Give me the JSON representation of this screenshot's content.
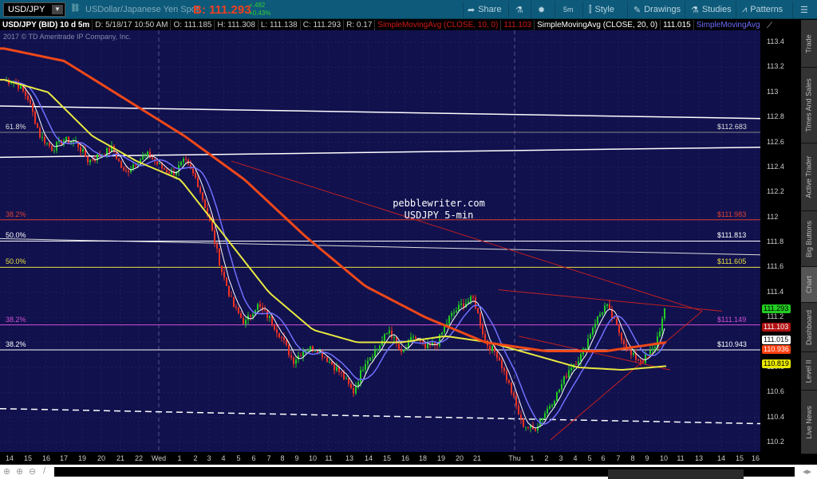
{
  "toolbar": {
    "symbol": "USD/JPY",
    "description": "USDollar/Japanese Yen Spot",
    "bid": "B: 111.293",
    "change": "+.482",
    "change_pct": "+0.43%",
    "share": "Share",
    "timeframe": "5m",
    "style": "Style",
    "drawings": "Drawings",
    "studies": "Studies",
    "patterns": "Patterns"
  },
  "info": {
    "title": "USD/JPY (BID) 10 d 5m",
    "date": "D: 5/18/17 10:50 AM",
    "open": "O: 111.185",
    "high": "H: 111.308",
    "low": "L: 111.138",
    "close": "C: 111.293",
    "range": "R: 0.17",
    "sma1": "SimpleMovingAvg (CLOSE, 10, 0)",
    "sma1_val": "111.103",
    "sma2": "SimpleMovingAvg (CLOSE, 20, 0)",
    "sma2_val": "111.015",
    "sma3": "SimpleMovingAvg ..."
  },
  "copyright": "2017 © TD Ameritrade IP Company, Inc.",
  "watermark": {
    "line1": "pebblewriter.com",
    "line2": "USDJPY 5-min"
  },
  "fib_labels": [
    {
      "pct": "61.8%",
      "price": 112.68,
      "value": "$112.683",
      "color": "#dddddd"
    },
    {
      "pct": "38.2%",
      "price": 111.98,
      "value": "$111.983",
      "color": "#e04030"
    },
    {
      "pct": "50.0%",
      "price": 111.81,
      "value": "$111.813",
      "color": "#ffffff"
    },
    {
      "pct": "50.0%",
      "price": 111.6,
      "value": "$111.605",
      "color": "#e8e040"
    },
    {
      "pct": "38.2%",
      "price": 111.14,
      "value": "$111.149",
      "color": "#d050d0"
    },
    {
      "pct": "38.2%",
      "price": 110.94,
      "value": "$110.943",
      "color": "#ffffff"
    }
  ],
  "y_ticks": [
    "113.4",
    "113.2",
    "113",
    "112.8",
    "112.6",
    "112.4",
    "112.2",
    "112",
    "111.8",
    "111.6",
    "111.4",
    "111.2",
    "111",
    "110.8",
    "110.6",
    "110.4",
    "110.2"
  ],
  "badges": [
    {
      "label": "111.293",
      "price": 111.29,
      "bg": "#22cc22",
      "fg": "#000"
    },
    {
      "label": "111.103",
      "price": 111.1,
      "bg": "#b01010",
      "fg": "#fff"
    },
    {
      "label": "111.015",
      "price": 111.01,
      "bg": "#ffffff",
      "fg": "#000"
    },
    {
      "label": "110.936",
      "price": 110.93,
      "bg": "#ff4010",
      "fg": "#fff"
    },
    {
      "label": "110.819",
      "price": 110.81,
      "bg": "#e8e800",
      "fg": "#000"
    }
  ],
  "x_ticks": [
    "14",
    "15",
    "16",
    "17",
    "19",
    "20",
    "21",
    "22",
    "Wed",
    "1",
    "2",
    "3",
    "4",
    "5",
    "6",
    "7",
    "8",
    "9",
    "10",
    "11",
    "13",
    "14",
    "15",
    "16",
    "18",
    "19",
    "20",
    "21",
    "Thu",
    "1",
    "2",
    "3",
    "4",
    "5",
    "6",
    "7",
    "8",
    "9",
    "10",
    "11",
    "13",
    "14",
    "15",
    "16"
  ],
  "side_tabs": [
    "Trade",
    "Times And Sales",
    "Active Trader",
    "Big Buttons",
    "Chart",
    "Dashboard",
    "Level II",
    "Live News"
  ],
  "chart_data": {
    "type": "candlestick",
    "symbol": "USD/JPY",
    "interval": "5m",
    "ylim": [
      110.1,
      113.5
    ],
    "price_path": [
      113.1,
      113.08,
      112.95,
      112.65,
      112.55,
      112.62,
      112.6,
      112.45,
      112.5,
      112.55,
      112.35,
      112.45,
      112.5,
      112.4,
      112.35,
      112.45,
      112.3,
      112.0,
      111.6,
      111.3,
      111.15,
      111.3,
      111.2,
      111.05,
      110.85,
      110.95,
      110.95,
      110.85,
      110.75,
      110.6,
      110.85,
      110.95,
      111.1,
      110.9,
      111.05,
      110.95,
      111.0,
      111.2,
      111.3,
      111.35,
      111.0,
      110.9,
      110.65,
      110.35,
      110.3,
      110.45,
      110.6,
      110.8,
      110.9,
      111.15,
      111.3,
      111.1,
      110.9,
      110.85,
      110.95,
      111.29
    ],
    "sma_red": [
      113.35,
      113.25,
      112.95,
      112.65,
      112.3,
      111.85,
      111.45,
      111.2,
      111.0,
      110.93,
      110.93,
      111.0
    ],
    "sma_yellow": [
      113.1,
      113.0,
      112.65,
      112.45,
      112.3,
      111.85,
      111.4,
      111.1,
      111.0,
      111.0,
      111.05,
      111.0,
      110.9,
      110.8,
      110.78,
      110.81
    ]
  }
}
